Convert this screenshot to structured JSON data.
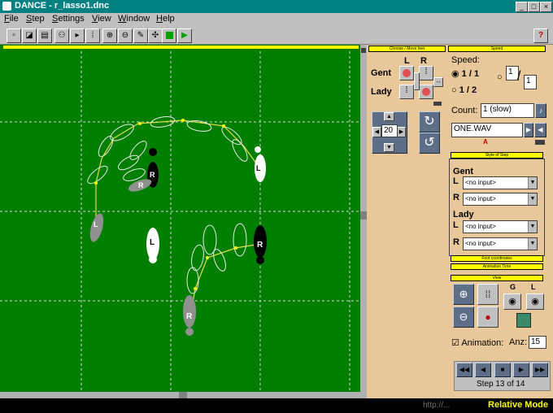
{
  "window": {
    "title": "DANCE - r_lasso1.dnc",
    "min_label": "_",
    "max_label": "□",
    "close_label": "×"
  },
  "menu": [
    {
      "key": "F",
      "rest": "ile"
    },
    {
      "key": "S",
      "rest": "tep"
    },
    {
      "key": "S",
      "rest": "ettings"
    },
    {
      "key": "V",
      "rest": "iew"
    },
    {
      "key": "W",
      "rest": "indow"
    },
    {
      "key": "H",
      "rest": "elp"
    }
  ],
  "toolbar_help": "?",
  "canvas": {
    "background": "#007e00",
    "footprint_labels": {
      "l1": "R",
      "l2": "R",
      "l3": "L",
      "l4": "L",
      "l5": "L",
      "l6": "R",
      "l7": "R"
    }
  },
  "panel": {
    "choose_title": "Choose / Move feet",
    "speed_title": "Speed",
    "gent_label": "Gent",
    "lady_label": "Lady",
    "col_l": "L",
    "col_r": "R",
    "step_value": "20",
    "speed_label": "Speed:",
    "speed_opt1": "1 / 1",
    "speed_opt2": "1 / 2",
    "frac_num": "1",
    "frac_den": "1",
    "count_label": "Count:",
    "count_value": "1 (slow)",
    "wav_value": "ONE.WAV",
    "wav_marker": "A",
    "style_title": "Style of Step",
    "gent_heading": "Gent",
    "lady_heading": "Lady",
    "row_l": "L",
    "row_r": "R",
    "no_input": "<no input>",
    "foot_coord_title": "Foot coordinates",
    "anim_time_title": "Animation Time",
    "view_title": "View",
    "view_g": "G",
    "view_l": "L",
    "animation_label": "Animation:",
    "anz_label": "Anz:",
    "anz_value": "15",
    "step_text": "Step 13 of 14"
  },
  "status": {
    "mode": "Relative Mode",
    "url": "http://..."
  }
}
